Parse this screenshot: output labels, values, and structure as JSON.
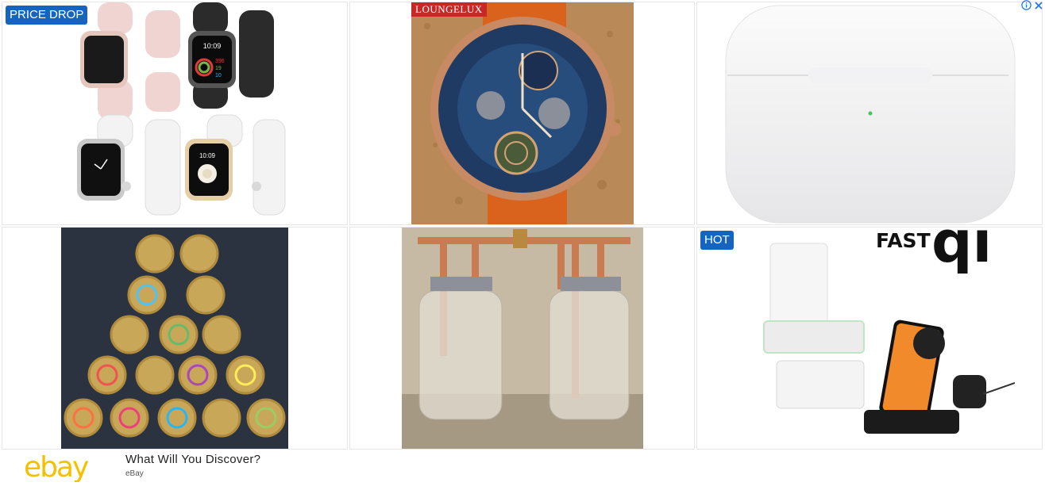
{
  "tiles": [
    {
      "badge": "PRICE DROP",
      "badge_color": "#1565c0",
      "product": "apple-watch-set"
    },
    {
      "brand_label": "LOUNGELUX",
      "product": "skeleton-watch"
    },
    {
      "product": "airpods-pro-case"
    },
    {
      "product": "coins-pyramid"
    },
    {
      "product": "copper-mason-jars"
    },
    {
      "badge": "HOT",
      "badge_color": "#1565c0",
      "product": "wireless-charger-stand",
      "brand_fast": "FAST",
      "brand_qi": "qi"
    }
  ],
  "watch_faces": {
    "tile1_top_right_time": "10:09",
    "tile1_bottom_right_time": "10:09"
  },
  "ad_choices": {
    "info_icon": "info-icon",
    "close_icon": "close-icon",
    "accent": "#1a73e8"
  },
  "footer": {
    "logo_text": "ebay",
    "logo_color": "#f5c000",
    "headline": "What Will You Discover?",
    "source": "eBay"
  }
}
